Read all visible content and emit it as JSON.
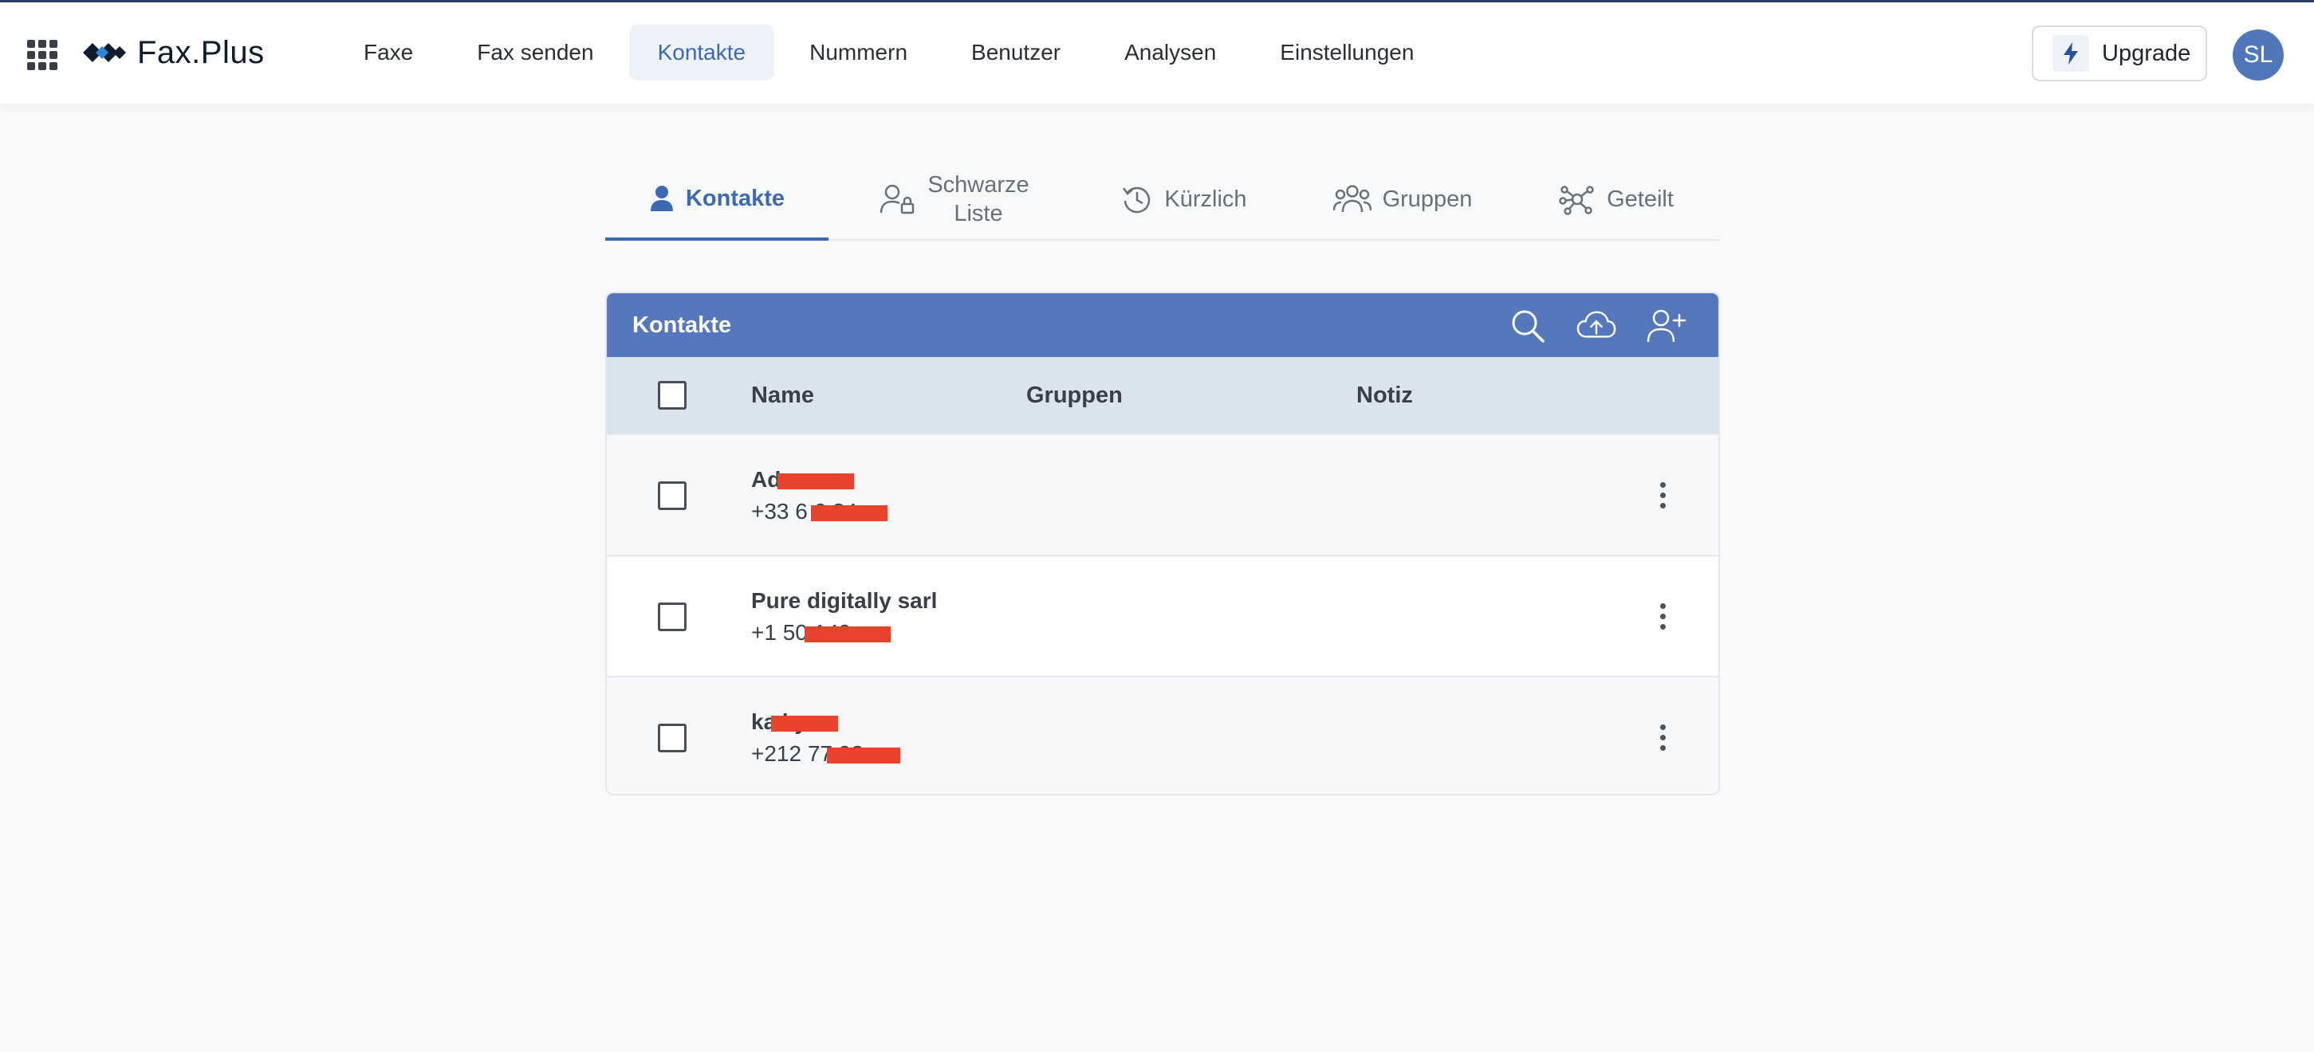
{
  "header": {
    "logo_text": "Fax.Plus",
    "nav": [
      {
        "label": "Faxe",
        "active": false
      },
      {
        "label": "Fax senden",
        "active": false
      },
      {
        "label": "Kontakte",
        "active": true
      },
      {
        "label": "Nummern",
        "active": false
      },
      {
        "label": "Benutzer",
        "active": false
      },
      {
        "label": "Analysen",
        "active": false
      },
      {
        "label": "Einstellungen",
        "active": false
      }
    ],
    "upgrade_label": "Upgrade",
    "avatar_initials": "SL"
  },
  "tabs": {
    "contacts": "Kontakte",
    "blacklist_line1": "Schwarze",
    "blacklist_line2": "Liste",
    "recent": "Kürzlich",
    "groups": "Gruppen",
    "shared": "Geteilt"
  },
  "card": {
    "title": "Kontakte",
    "columns": {
      "name": "Name",
      "groups": "Gruppen",
      "note": "Notiz"
    },
    "rows": [
      {
        "name": "Ad       o",
        "phone": "+33 6           6 34"
      },
      {
        "name": "Pure digitally sarl",
        "phone": "+1 50          149"
      },
      {
        "name": "ka          ky",
        "phone": "+212 77         92"
      }
    ]
  },
  "colors": {
    "accent": "#3d68b3",
    "card_header": "#5577bb",
    "table_header": "#d9e4ef",
    "redaction": "#e8432c"
  },
  "icons": {
    "apps": "apps-grid-icon",
    "logo": "fax-plus-logo-icon",
    "upgrade": "lightning-icon",
    "tab_contacts": "person-icon",
    "tab_blacklist": "person-lock-icon",
    "tab_recent": "history-icon",
    "tab_groups": "people-icon",
    "tab_shared": "share-network-icon",
    "search": "search-icon",
    "upload": "cloud-upload-icon",
    "add_contact": "person-add-icon",
    "row_menu": "kebab-menu-icon"
  }
}
